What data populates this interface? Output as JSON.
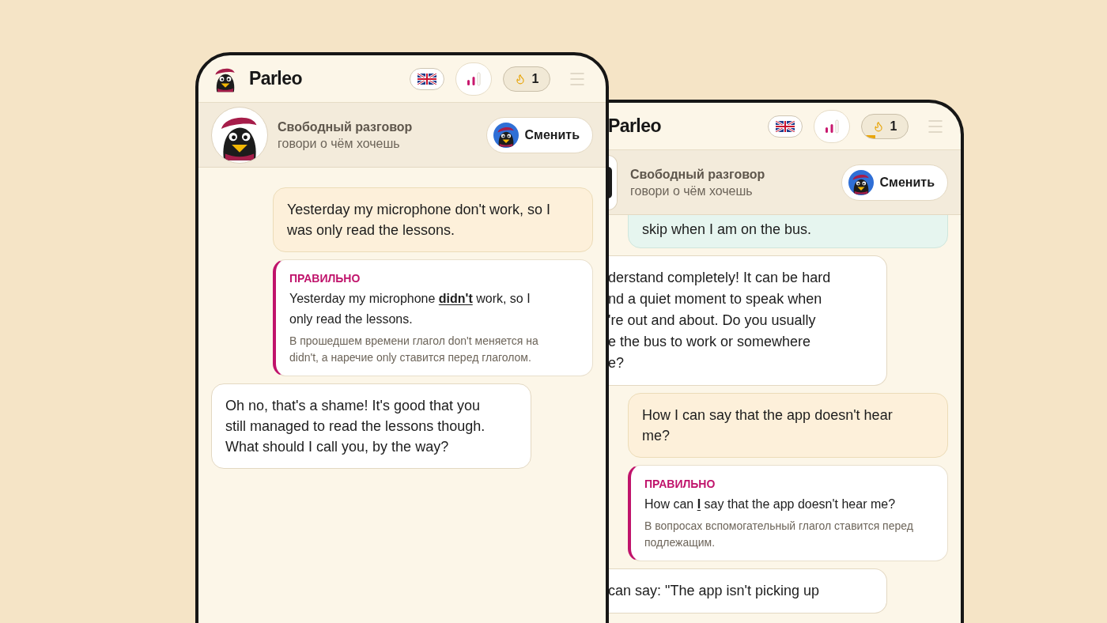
{
  "phones": [
    {
      "kind": "front",
      "header": {
        "logo": "Parleo",
        "streak": {
          "count": "1",
          "level": 0
        }
      },
      "topic": {
        "title": "Свободный разговор",
        "subtitle": "говори о чём хочешь",
        "button": "Сменить"
      },
      "messages": [
        {
          "kind": "user",
          "text": "Yesterday my microphone don't work, so I was only read the lessons."
        },
        {
          "kind": "correction",
          "label": "ПРАВИЛЬНО",
          "text": "Yesterday my microphone **didn't** work, so I only read the lessons.",
          "note": "В прошедшем времени глагол don't меняется на didn't, а наречие only ставится перед глаголом."
        },
        {
          "kind": "bot",
          "text": "Oh no, that's a shame! It's good that you still managed to read the lessons though. What should I call you, by the way?"
        }
      ]
    },
    {
      "kind": "back",
      "header": {
        "logo": "Parleo",
        "streak": {
          "count": "1",
          "level": 0.3
        }
      },
      "topic": {
        "title": "Свободный разговор",
        "subtitle": "говори о чём хочешь",
        "button": "Сменить"
      },
      "messages": [
        {
          "kind": "hint",
          "text": "skip when I am on the bus."
        },
        {
          "kind": "bot",
          "lines": [
            "derstand completely! It can be hard",
            "nd a quiet moment to speak when",
            "'re out and about. Do you usually",
            "e the bus to work or somewhere",
            "e?"
          ]
        },
        {
          "kind": "user",
          "text": "How I can say that the app doesn't hear me?"
        },
        {
          "kind": "correction",
          "label": "ПРАВИЛЬНО",
          "text": "How can **I** say that the app doesn't hear me?",
          "note": "В вопросах вспомогательный глагол ставится перед подлежащим."
        },
        {
          "kind": "bot",
          "lines": [
            "can say: \"The app isn't picking up"
          ]
        }
      ]
    }
  ]
}
